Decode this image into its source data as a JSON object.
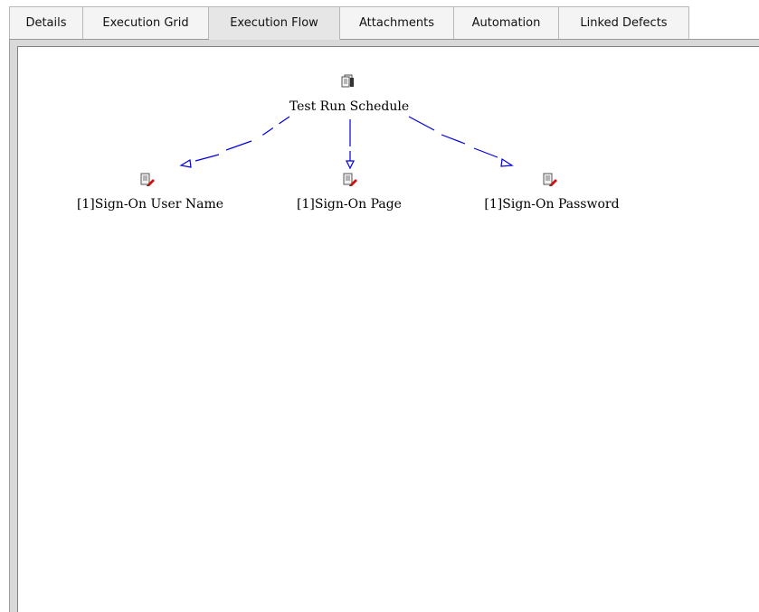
{
  "tabs": [
    {
      "label": "Details",
      "active": false
    },
    {
      "label": "Execution Grid",
      "active": false
    },
    {
      "label": "Execution Flow",
      "active": true
    },
    {
      "label": "Attachments",
      "active": false
    },
    {
      "label": "Automation",
      "active": false
    },
    {
      "label": "Linked Defects",
      "active": false
    }
  ],
  "flow": {
    "root": {
      "label": "Test Run Schedule",
      "icon": "test-set-icon"
    },
    "children": [
      {
        "label": "[1]Sign-On User Name",
        "icon": "test-instance-icon"
      },
      {
        "label": "[1]Sign-On Page",
        "icon": "test-instance-icon"
      },
      {
        "label": "[1]Sign-On Password",
        "icon": "test-instance-icon"
      }
    ],
    "edge_color": "#0000e0"
  },
  "colors": {
    "tab_background": "#f4f4f4",
    "tab_active_background": "#e6e6e6",
    "canvas_background": "#ffffff",
    "frame_border": "#808080"
  }
}
